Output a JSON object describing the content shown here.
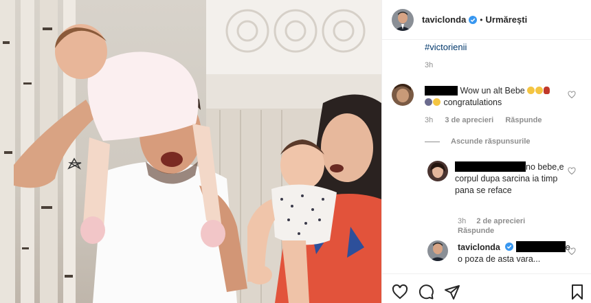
{
  "post": {
    "username": "taviclonda",
    "separator": "•",
    "follow_label": "Urmărești",
    "hashtag": "#victorienii",
    "caption_time": "3h"
  },
  "comments": [
    {
      "text": "Wow un alt Bebe",
      "text2": "congratulations",
      "time": "3h",
      "likes": "3 de aprecieri",
      "reply_label": "Răspunde",
      "hide_replies_label": "Ascunde răspunsurile"
    },
    {
      "text_suffix": "no",
      "text": "bebe,e corpul dupa sarcina ia timp pana se reface",
      "time": "3h",
      "likes": "2 de aprecieri",
      "reply_label": "Răspunde"
    },
    {
      "username": "taviclonda",
      "text_suffix": "e",
      "text": "o poza de asta vara..."
    }
  ],
  "icons": [
    "verified-badge-icon",
    "heart-icon",
    "comment-icon",
    "share-icon",
    "bookmark-icon"
  ],
  "colors": {
    "link": "#00376b",
    "meta": "#8e8e8e",
    "verified": "#3897f0"
  }
}
